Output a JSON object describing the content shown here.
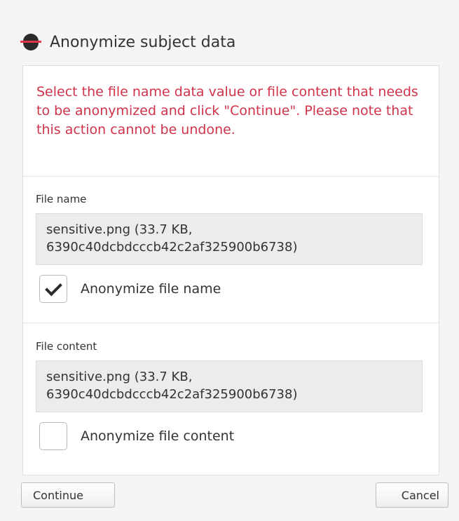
{
  "dialog": {
    "title": "Anonymize subject data",
    "warning": "Select the file name data value or file content that needs to be anonymized and click \"Continue\". Please note that this action cannot be undone."
  },
  "file_name_section": {
    "label": "File name",
    "value_line1": "sensitive.png (33.7 KB,",
    "value_line2": "6390c40dcbdcccb42c2af325900b6738)",
    "checkbox_label": "Anonymize file name",
    "checked": true
  },
  "file_content_section": {
    "label": "File content",
    "value_line1": "sensitive.png (33.7 KB,",
    "value_line2": "6390c40dcbdcccb42c2af325900b6738)",
    "checkbox_label": "Anonymize file content",
    "checked": false
  },
  "buttons": {
    "continue": "Continue",
    "cancel": "Cancel"
  },
  "colors": {
    "warning": "#d0334a",
    "icon_line": "#e0344b"
  },
  "icons": {
    "header": "anonymize-icon",
    "check": "checkmark-icon"
  }
}
